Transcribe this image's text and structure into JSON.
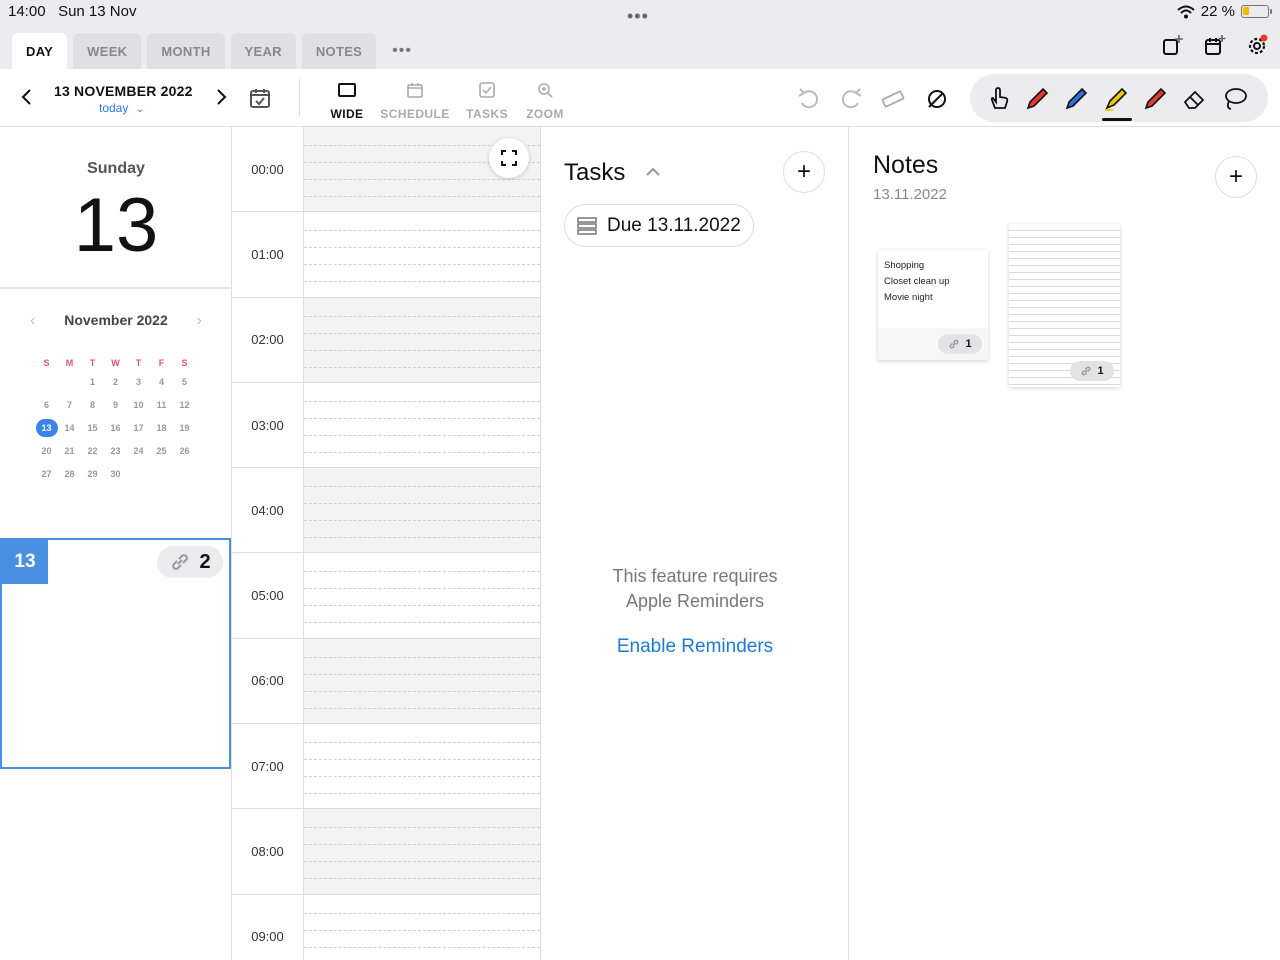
{
  "status_bar": {
    "time": "14:00",
    "date": "Sun 13 Nov",
    "battery": "22 %"
  },
  "tabs": [
    {
      "label": "DAY",
      "active": true
    },
    {
      "label": "WEEK",
      "active": false
    },
    {
      "label": "MONTH",
      "active": false
    },
    {
      "label": "YEAR",
      "active": false
    },
    {
      "label": "NOTES",
      "active": false
    }
  ],
  "tabs_more": "•••",
  "top_icons": [
    "new-note-icon",
    "new-calendar-icon",
    "settings-icon"
  ],
  "toolbar": {
    "date_title": "13 NOVEMBER 2022",
    "today_label": "today",
    "views": [
      {
        "label": "WIDE",
        "active": true
      },
      {
        "label": "SCHEDULE",
        "active": false
      },
      {
        "label": "TASKS",
        "active": false
      },
      {
        "label": "ZOOM",
        "active": false
      }
    ],
    "pens": [
      "hand-tool-icon",
      "red-pencil-icon",
      "blue-pen-icon",
      "yellow-highlighter-icon",
      "red-marker-icon",
      "eraser-icon",
      "lasso-icon"
    ],
    "selected_pen": "yellow-highlighter-icon"
  },
  "day_header": {
    "weekday": "Sunday",
    "day": "13"
  },
  "mini_calendar": {
    "title": "November 2022",
    "weekdays": [
      "S",
      "M",
      "T",
      "W",
      "T",
      "F",
      "S"
    ],
    "rows": [
      [
        "",
        "",
        "1",
        "2",
        "3",
        "4",
        "5"
      ],
      [
        "6",
        "7",
        "8",
        "9",
        "10",
        "11",
        "12"
      ],
      [
        "13",
        "14",
        "15",
        "16",
        "17",
        "18",
        "19"
      ],
      [
        "20",
        "21",
        "22",
        "23",
        "24",
        "25",
        "26"
      ],
      [
        "27",
        "28",
        "29",
        "30",
        "",
        "",
        ""
      ]
    ],
    "selected": "13"
  },
  "day_card": {
    "day": "13",
    "link_count": "2"
  },
  "hours": [
    "00:00",
    "01:00",
    "02:00",
    "03:00",
    "04:00",
    "05:00",
    "06:00",
    "07:00",
    "08:00",
    "09:00"
  ],
  "tasks": {
    "title": "Tasks",
    "due_label": "Due 13.11.2022",
    "requires_line1": "This feature requires",
    "requires_line2": "Apple Reminders",
    "enable_label": "Enable Reminders"
  },
  "notes": {
    "title": "Notes",
    "date": "13.11.2022",
    "cards": [
      {
        "lines": [
          "Shopping",
          "Closet clean up",
          "Movie night"
        ],
        "link_count": "1"
      },
      {
        "lines": [],
        "link_count": "1"
      }
    ]
  },
  "colors": {
    "accent": "#4a90e2",
    "link": "#1d7ad9",
    "weekday_red": "#e0566a"
  }
}
